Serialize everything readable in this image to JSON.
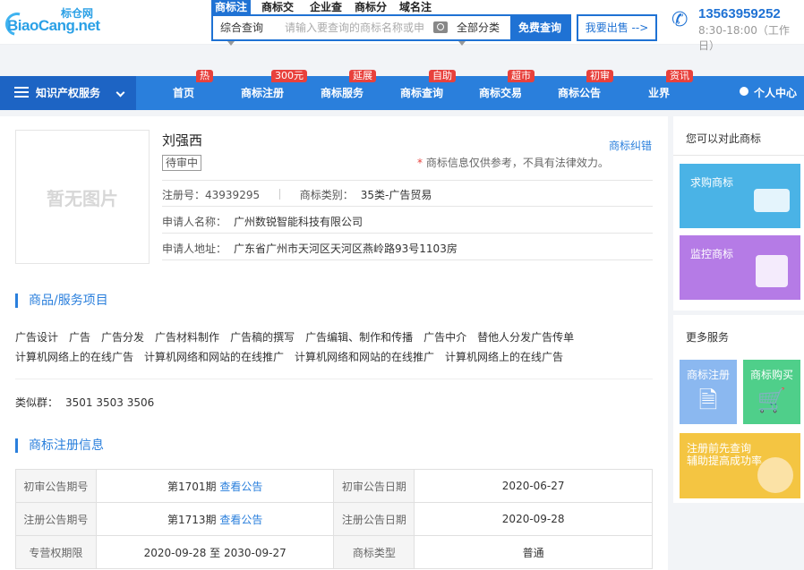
{
  "header": {
    "logo_cn": "标仓网",
    "logo_en": "BiaoCang.net",
    "search_tabs": [
      "商标注",
      "商标交易",
      "企业查",
      "商标分",
      "域名注"
    ],
    "search_scope": "综合查询",
    "search_placeholder": "请输入要查询的商标名称或申",
    "search_category": "全部分类",
    "search_button": "免费查询",
    "sell_button": "我要出售 -->",
    "phone": "13563959252",
    "hours": "8:30-18:00（工作日）"
  },
  "nav": {
    "category": "知识产权服务",
    "items": [
      {
        "label": "首页",
        "badge": "热"
      },
      {
        "label": "商标注册",
        "badge": "300元"
      },
      {
        "label": "商标服务",
        "badge": "延展"
      },
      {
        "label": "商标查询",
        "badge": "自助"
      },
      {
        "label": "商标交易",
        "badge": "超市"
      },
      {
        "label": "商标公告",
        "badge": "初审"
      },
      {
        "label": "业界",
        "badge": "资讯"
      }
    ],
    "user_center": "个人中心"
  },
  "trademark": {
    "image_placeholder": "暂无图片",
    "name": "刘强西",
    "status": "待审中",
    "correct_link": "商标纠错",
    "disclaimer_star": "*",
    "disclaimer": "商标信息仅供参考，不具有法律效力。",
    "reg_no_label": "注册号：",
    "reg_no": "43939295",
    "class_label": "商标类别：",
    "class": "35类-广告贸易",
    "applicant_label": "申请人名称：",
    "applicant": "广州数锐智能科技有限公司",
    "address_label": "申请人地址：",
    "address": "广东省广州市天河区天河区燕岭路93号1103房"
  },
  "goods": {
    "title": "商品/服务项目",
    "items": [
      "广告设计",
      "广告",
      "广告分发",
      "广告材料制作",
      "广告稿的撰写",
      "广告编辑、制作和传播",
      "广告中介",
      "替他人分发广告传单",
      "计算机网络上的在线广告",
      "计算机网络和网站的在线推广",
      "计算机网络和网站的在线推广",
      "计算机网络上的在线广告"
    ],
    "similar_label": "类似群：",
    "similar": "3501 3503 3506"
  },
  "registration": {
    "title": "商标注册信息",
    "rows": [
      {
        "l1": "初审公告期号",
        "v1": "第1701期",
        "link1": "查看公告",
        "l2": "初审公告日期",
        "v2": "2020-06-27"
      },
      {
        "l1": "注册公告期号",
        "v1": "第1713期",
        "link1": "查看公告",
        "l2": "注册公告日期",
        "v2": "2020-09-28"
      },
      {
        "l1": "专营权期限",
        "v1": "2020-09-28 至 2030-09-27",
        "link1": "",
        "l2": "商标类型",
        "v2": "普通"
      }
    ]
  },
  "sidebar": {
    "compare_title": "您可以对此商标",
    "buy_card": "求购商标",
    "monitor_card": "监控商标",
    "more_title": "更多服务",
    "tile_register": "商标注册",
    "tile_buy": "商标购买",
    "promo_line1": "注册前先查询",
    "promo_line2": "辅助提高成功率",
    "colors": {
      "buy": "#4ab3e6",
      "monitor": "#b57be6",
      "register": "#8bb8f0",
      "purchase": "#4fcf8a",
      "promo": "#f4c542"
    }
  }
}
